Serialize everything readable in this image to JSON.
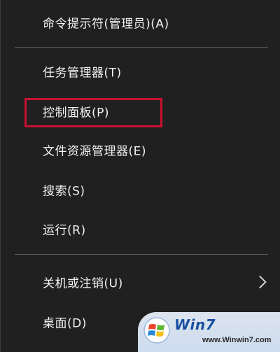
{
  "menu": {
    "items": [
      {
        "label": "命令提示符(管理员)(A)"
      },
      {
        "label": "任务管理器(T)"
      },
      {
        "label": "控制面板(P)"
      },
      {
        "label": "文件资源管理器(E)"
      },
      {
        "label": "搜索(S)"
      },
      {
        "label": "运行(R)"
      },
      {
        "label": "关机或注销(U)"
      },
      {
        "label": "桌面(D)"
      }
    ]
  },
  "watermark": {
    "brand": "Win7",
    "url": "www.Winwin7.com",
    "logo_icon": "windows-flag-icon"
  },
  "colors": {
    "background": "#202020",
    "text": "#f2f2f2",
    "separator": "#5a5a5a",
    "highlight": "#c8102e"
  }
}
